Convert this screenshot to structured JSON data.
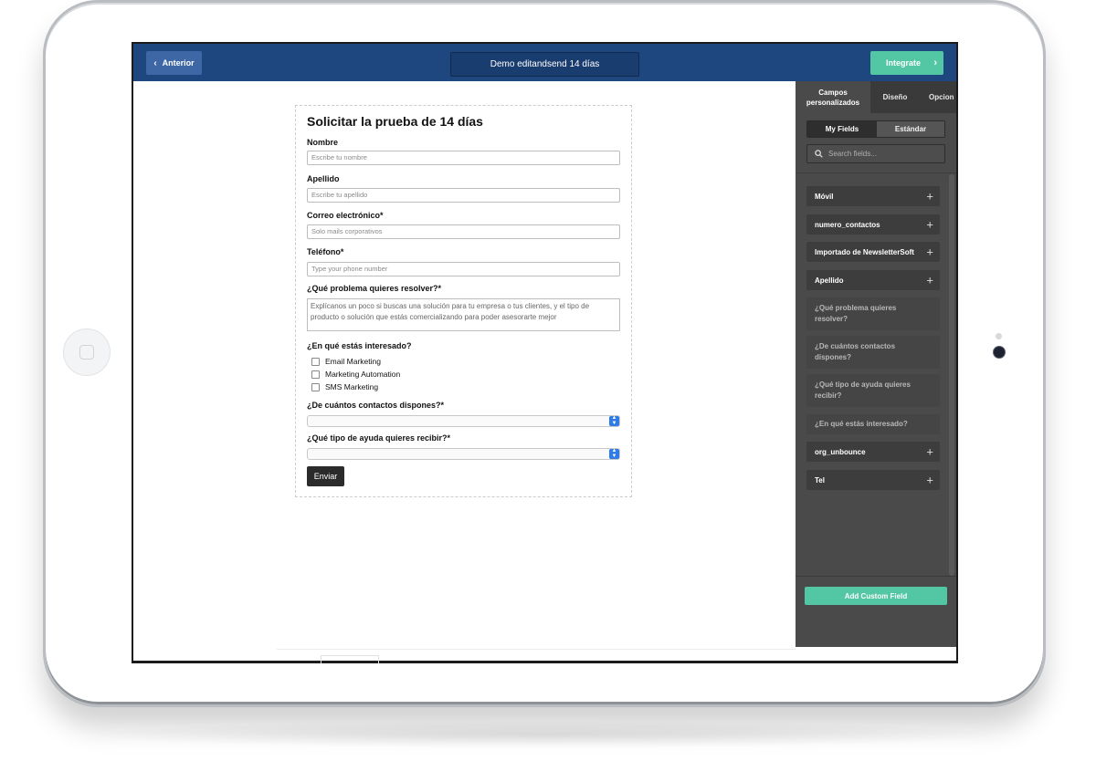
{
  "topbar": {
    "prev_label": "Anterior",
    "title": "Demo editandsend 14 días",
    "integrate_label": "Integrate",
    "colors": {
      "bar": "#1f477f",
      "integrate": "#53c7a3"
    }
  },
  "form": {
    "heading": "Solicitar la prueba de 14 días",
    "fields": [
      {
        "label": "Nombre",
        "placeholder": "Escribe tu nombre"
      },
      {
        "label": "Apellido",
        "placeholder": "Escribe tu apellido"
      },
      {
        "label": "Correo electrónico*",
        "placeholder": "Solo mails corporativos"
      },
      {
        "label": "Teléfono*",
        "placeholder": "Type your phone number"
      }
    ],
    "problem": {
      "label": "¿Qué problema quieres resolver?*",
      "placeholder": "Explícanos un poco si buscas una solución para tu empresa o tus clientes, y el tipo de producto o solución que estás comercializando para poder asesorarte mejor"
    },
    "interest": {
      "label": "¿En qué estás interesado?",
      "options": [
        "Email Marketing",
        "Marketing Automation",
        "SMS Marketing"
      ]
    },
    "contacts_label": "¿De cuántos contactos dispones?*",
    "help_label": "¿Qué tipo de ayuda quieres recibir?*",
    "submit_label": "Enviar"
  },
  "panel": {
    "tabs": [
      "Campos personalizados",
      "Diseño",
      "Opcion"
    ],
    "toggle": [
      "My Fields",
      "Estándar"
    ],
    "search_placeholder": "Search fields...",
    "fields": [
      {
        "label": "Móvil",
        "addable": true
      },
      {
        "label": "numero_contactos",
        "addable": true
      },
      {
        "label": "Importado de NewsletterSoft",
        "addable": true
      },
      {
        "label": "Apellido",
        "addable": true
      },
      {
        "label": "¿Qué problema quieres resolver?",
        "addable": false
      },
      {
        "label": "¿De cuántos contactos dispones?",
        "addable": false
      },
      {
        "label": "¿Qué tipo de ayuda quieres recibir?",
        "addable": false
      },
      {
        "label": "¿En qué estás interesado?",
        "addable": false
      },
      {
        "label": "org_unbounce",
        "addable": true
      },
      {
        "label": "Tel",
        "addable": true
      }
    ],
    "add_button": "Add Custom Field"
  }
}
